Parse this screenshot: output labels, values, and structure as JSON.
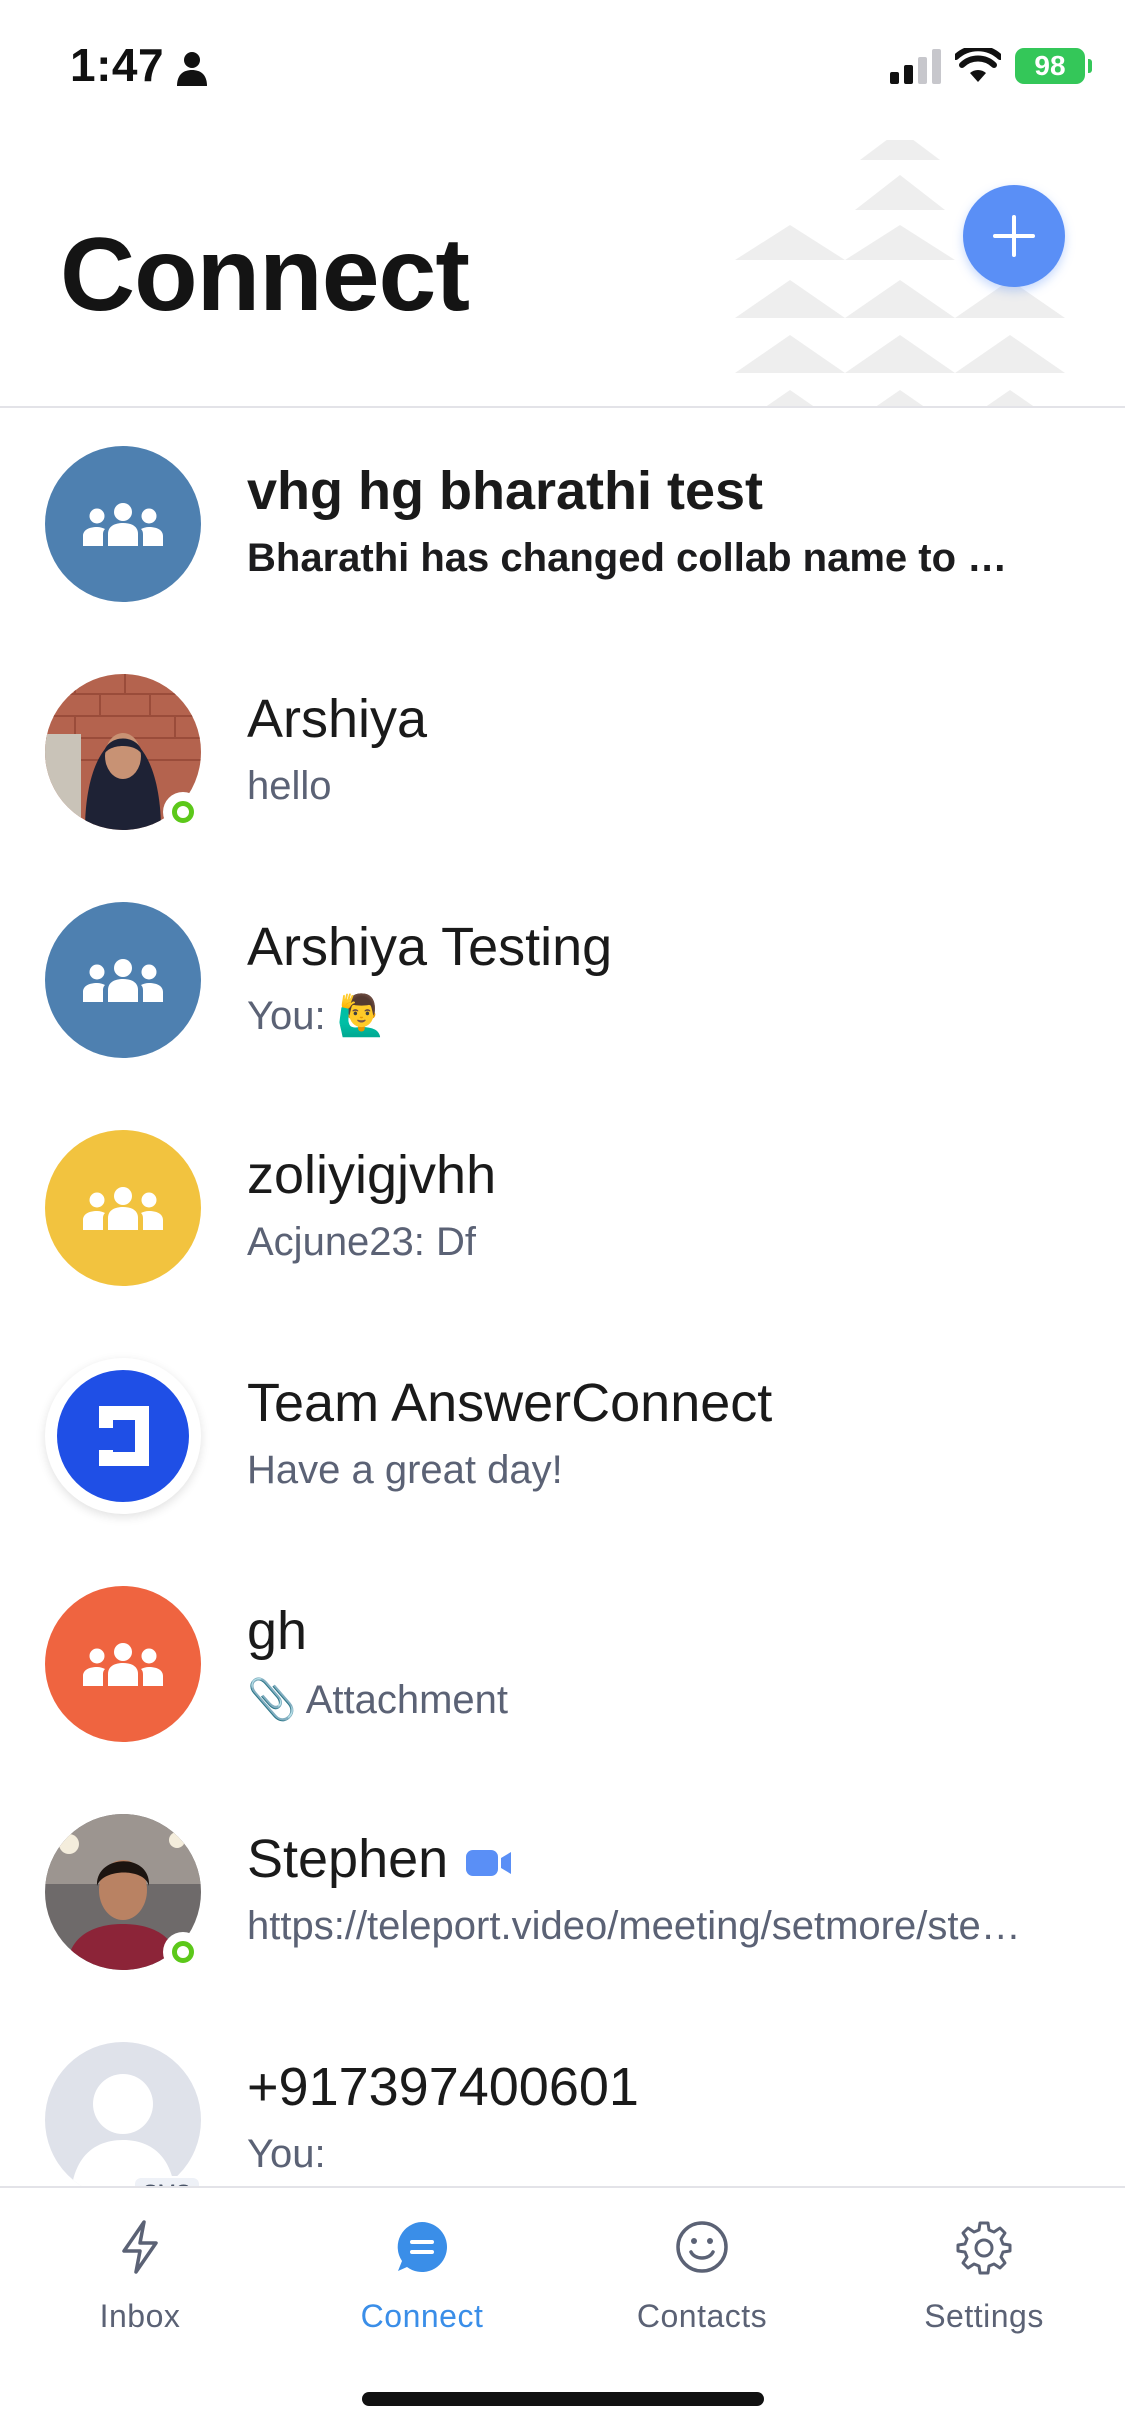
{
  "status_bar": {
    "time": "1:47",
    "battery": "98"
  },
  "header": {
    "title": "Connect"
  },
  "conversations": [
    {
      "name": "vhg hg bharathi test",
      "preview": "Bharathi has changed collab name to vhg hg bharathi test",
      "avatar_type": "group",
      "avatar_color": "#4e80b0",
      "unread": true
    },
    {
      "name": "Arshiya",
      "preview": "hello",
      "avatar_type": "photo",
      "online": true
    },
    {
      "name": "Arshiya Testing",
      "preview": "You: 🙋‍♂️",
      "avatar_type": "group",
      "avatar_color": "#4e80b0"
    },
    {
      "name": "zoliyigjvhh",
      "preview": "Acjune23: Df",
      "avatar_type": "group",
      "avatar_color": "#f2c33f"
    },
    {
      "name": "Team AnswerConnect",
      "preview": "Have a great day!",
      "avatar_type": "logo",
      "avatar_color": "#1f4fe6"
    },
    {
      "name": "gh",
      "preview": "📎 Attachment",
      "avatar_type": "group",
      "avatar_color": "#ef6440"
    },
    {
      "name": "Stephen",
      "preview": "https://teleport.video/meeting/setmore/stephen",
      "avatar_type": "photo",
      "online": true,
      "video_icon": "video-camera-icon"
    },
    {
      "name": "+917397400601",
      "preview": "You:",
      "avatar_type": "placeholder",
      "badge": "SMS"
    }
  ],
  "tabs": [
    {
      "label": "Inbox",
      "icon": "lightning-icon",
      "active": false
    },
    {
      "label": "Connect",
      "icon": "chat-bubble-icon",
      "active": true
    },
    {
      "label": "Contacts",
      "icon": "smiley-icon",
      "active": false
    },
    {
      "label": "Settings",
      "icon": "gear-icon",
      "active": false
    }
  ],
  "colors": {
    "accent": "#3a8ee8",
    "fab": "#5a8ff6",
    "online": "#5cc81a",
    "battery": "#34c759"
  }
}
